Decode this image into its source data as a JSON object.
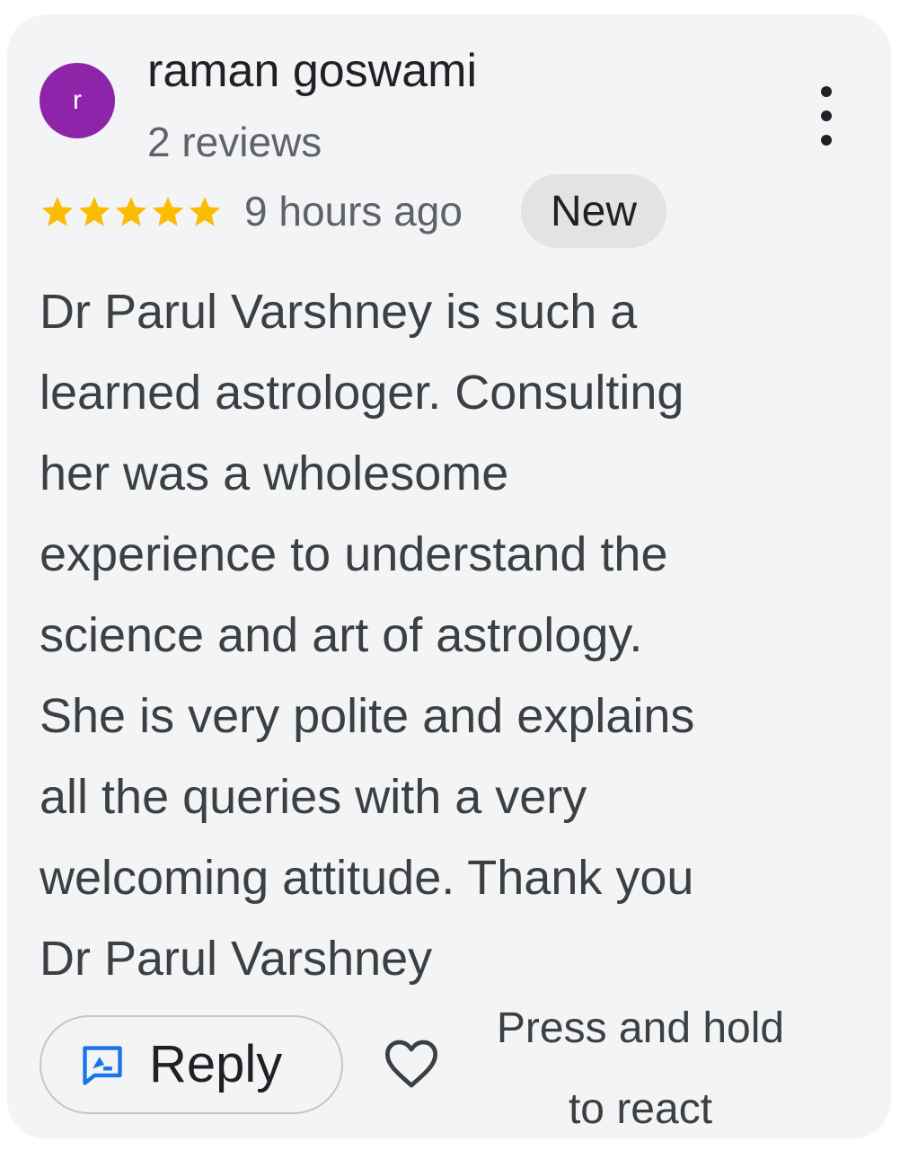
{
  "review": {
    "avatar_letter": "r",
    "avatar_color": "#8e24aa",
    "reviewer_name": "raman goswami",
    "review_count": "2 reviews",
    "rating": 5,
    "max_rating": 5,
    "star_color": "#fbbc04",
    "time_ago": "9 hours ago",
    "badge": "New",
    "text": "Dr Parul Varshney is such a\nlearned astrologer. Consulting\nher was a wholesome\nexperience to understand the\nscience and art of astrology.\nShe is very polite and explains\nall the queries with a very\nwelcoming attitude. Thank you\nDr Parul Varshney"
  },
  "actions": {
    "reply_label": "Reply",
    "reply_icon": "rate-review-icon",
    "reply_icon_color": "#1a73e8",
    "like_icon": "heart-outline-icon",
    "menu_icon": "more-vert-icon",
    "react_hint": "Press and hold\nto react"
  }
}
